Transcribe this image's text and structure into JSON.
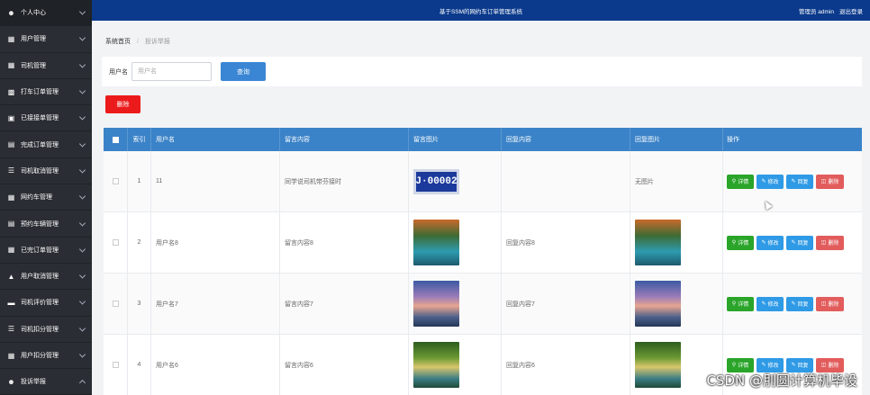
{
  "app": {
    "title": "基于SSM的网约车订单管理系统",
    "user_label": "管理员 admin",
    "logout": "退出登录"
  },
  "sidebar": {
    "items": [
      {
        "label": "个人中心",
        "icon": "user-icon"
      },
      {
        "label": "用户管理",
        "icon": "grid-icon"
      },
      {
        "label": "司机管理",
        "icon": "grid-icon"
      },
      {
        "label": "打车订单管理",
        "icon": "bar-chart-icon"
      },
      {
        "label": "已接接单管理",
        "icon": "monitor-icon"
      },
      {
        "label": "完成订单管理",
        "icon": "doc-icon"
      },
      {
        "label": "司机取消管理",
        "icon": "list-icon"
      },
      {
        "label": "网约车管理",
        "icon": "grid-icon"
      },
      {
        "label": "预约车辆管理",
        "icon": "doc-icon"
      },
      {
        "label": "已完订单管理",
        "icon": "grid-icon"
      },
      {
        "label": "用户取消管理",
        "icon": "thumb-icon"
      },
      {
        "label": "司机评价管理",
        "icon": "card-icon"
      },
      {
        "label": "司机扣分管理",
        "icon": "list-icon"
      },
      {
        "label": "用户扣分管理",
        "icon": "grid-icon"
      },
      {
        "label": "投诉举报",
        "icon": "user-icon"
      }
    ]
  },
  "breadcrumb": {
    "home": "系统首页",
    "current": "投诉举报"
  },
  "search": {
    "label": "用户名",
    "placeholder": "用户名",
    "value": "",
    "query_button": "查询"
  },
  "toolbar": {
    "delete_label": "删除"
  },
  "table": {
    "headers": [
      "索引",
      "用户名",
      "留言内容",
      "留言图片",
      "回复内容",
      "回复图片",
      "操作"
    ],
    "rows": [
      {
        "index": "1",
        "username": "11",
        "message": "同学说司机带芬接时",
        "message_image": "license-plate-image",
        "plate_text": "J·00002",
        "reply": "",
        "reply_image_text": "无图片",
        "reply_image": ""
      },
      {
        "index": "2",
        "username": "用户名8",
        "message": "留言内容8",
        "message_image": "autumn-lake-image",
        "reply": "回复内容8",
        "reply_image_text": "",
        "reply_image": "autumn-lake-image"
      },
      {
        "index": "3",
        "username": "用户名7",
        "message": "留言内容7",
        "message_image": "sunset-mountain-image",
        "reply": "回复内容7",
        "reply_image_text": "",
        "reply_image": "sunset-mountain-image"
      },
      {
        "index": "4",
        "username": "用户名6",
        "message": "留言内容6",
        "message_image": "forest-waterfall-image",
        "reply": "回复内容6",
        "reply_image_text": "",
        "reply_image": "forest-waterfall-image"
      }
    ],
    "actions": {
      "detail": "详情",
      "edit": "修改",
      "reply": "回复",
      "delete": "删除"
    }
  },
  "watermark": "CSDN @刖圆计算机毕设"
}
